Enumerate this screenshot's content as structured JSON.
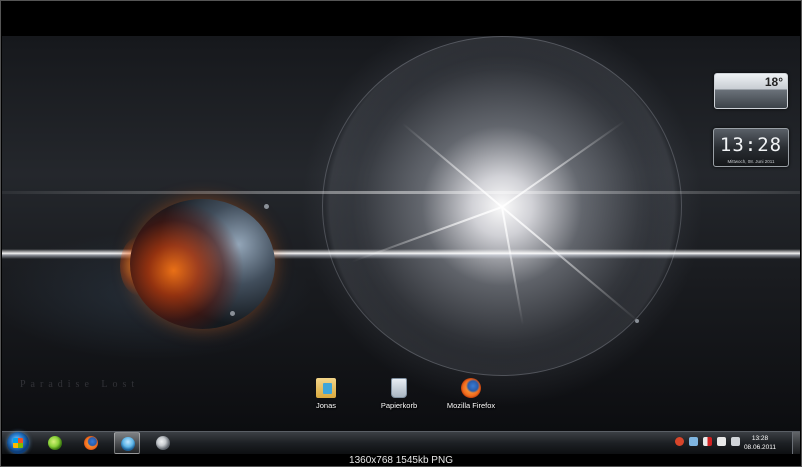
{
  "desktop": {
    "wallpaper_watermark": "Paradise Lost",
    "icons": [
      {
        "label": "Jonas",
        "icon": "folder-icon"
      },
      {
        "label": "Papierkorb",
        "icon": "recycle-bin-icon"
      },
      {
        "label": "Mozilla Firefox",
        "icon": "firefox-icon"
      }
    ]
  },
  "gadgets": {
    "weather": {
      "temperature": "18°"
    },
    "clock": {
      "time": "13:28",
      "date": "Mittwoch, 08. Juni 2011"
    }
  },
  "taskbar": {
    "start": {
      "icon": "windows-start-icon"
    },
    "pinned": [
      {
        "name": "messenger",
        "icon": "messenger-icon",
        "color": "#8bd23a"
      },
      {
        "name": "firefox",
        "icon": "firefox-icon",
        "color": "#f26b1d"
      },
      {
        "name": "windows-live",
        "icon": "people-icon",
        "color": "#5fb6e8",
        "active": true
      },
      {
        "name": "steam",
        "icon": "steam-icon",
        "color": "#c8ccd0"
      }
    ],
    "tray": {
      "icons": [
        "flash-icon",
        "network-tray-icon",
        "volume-muted-icon",
        "action-center-icon",
        "volume-icon"
      ],
      "time": "13:28",
      "date": "08.06.2011"
    }
  },
  "caption": "1360x768 1545kb PNG"
}
